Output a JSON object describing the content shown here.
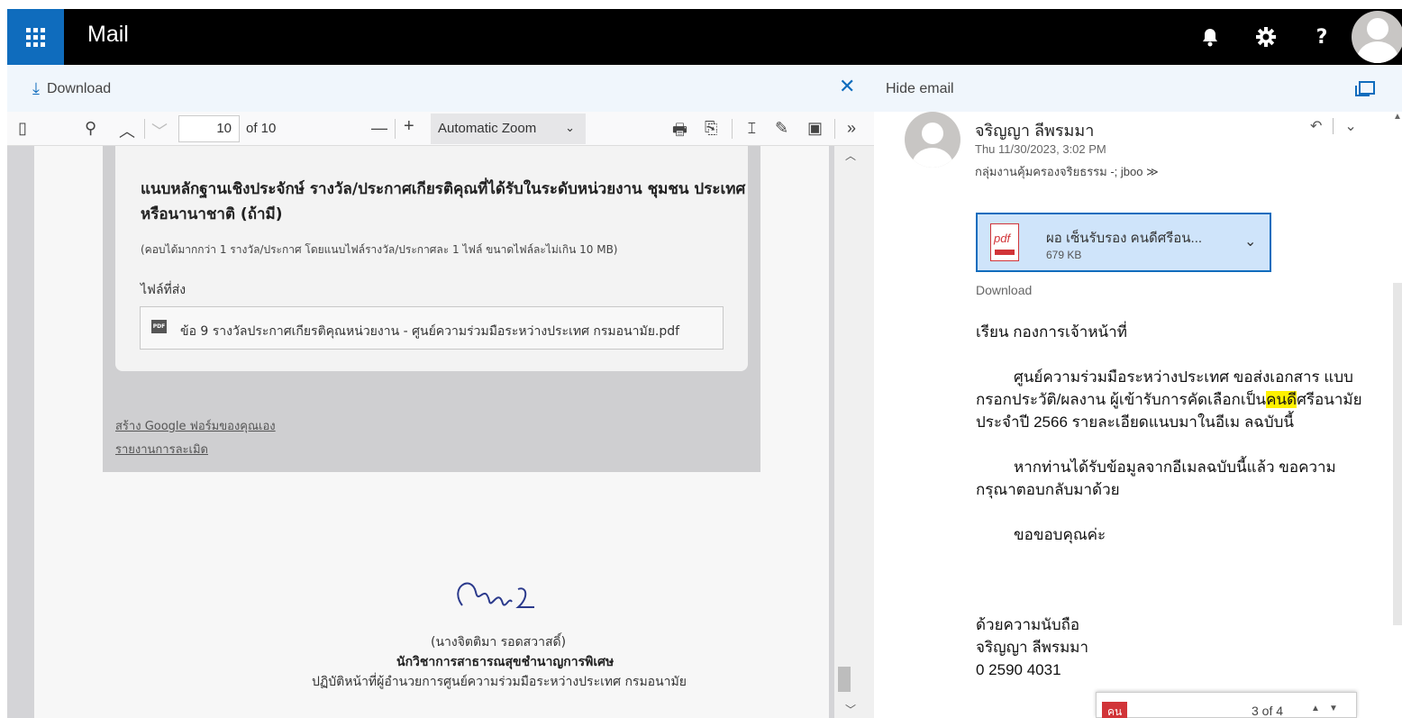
{
  "app": {
    "title": "Mail",
    "accent_color": "#0F6CBD",
    "icons": {
      "apps": "waffle-icon",
      "notifications": "bell-icon",
      "settings": "gear-icon",
      "help": "help-icon",
      "account": "avatar"
    }
  },
  "command_bar": {
    "download_label": "Download",
    "close_icon": "close-icon",
    "hide_email_label": "Hide email"
  },
  "pdf_toolbar": {
    "page_value": "10",
    "page_of": "of 10",
    "zoom_label": "Automatic Zoom"
  },
  "pdf_page": {
    "question_title": "แนบหลักฐานเชิงประจักษ์ รางวัล/ประกาศเกียรติคุณที่ได้รับในระดับหน่วยงาน ชุมชน ประเทศ หรือนานาชาติ (ถ้ามี)",
    "question_desc": "(คอบได้มากกว่า 1 รางวัล/ประกาศ โดยแนบไฟล์รางวัล/ประกาศละ 1 ไฟล์ ขนาดไฟล์ละไม่เกิน 10 MB)",
    "files_label": "ไฟล์ที่ส่ง",
    "file_name": "ข้อ 9 รางวัลประกาศเกียรติคุณหน่วยงาน - ศูนย์ความร่วมมือระหว่างประเทศ กรมอนามัย.pdf",
    "link_create_form": "สร้าง Google ฟอร์มของคุณเอง",
    "link_report": "รายงานการละเมิด",
    "signer_name": "(นางจิตติมา รอดสวาสดิ์)",
    "signer_position": "นักวิชาการสาธารณสุขชำนาญการพิเศษ",
    "signer_department": "ปฏิบัติหน้าที่ผู้อำนวยการศูนย์ความร่วมมือระหว่างประเทศ กรมอนามัย"
  },
  "email": {
    "sender": "จริญญา ลีพรมมา",
    "date": "Thu 11/30/2023, 3:02 PM",
    "to": "กลุ่มงานคุ้มครองจริยธรรม -; jboo ≫",
    "attachment": {
      "name": "ผอ เซ็นรับรอง คนดีศรีอน...",
      "size": "679 KB",
      "type_label": "pdf"
    },
    "download_label": "Download",
    "greeting": "เรียน กองการเจ้าหน้าที่",
    "para1_a": "ศูนย์ความร่วมมือระหว่างประเทศ ขอส่งเอกสาร แบบกรอกประวัติ/ผลงาน ผู้เข้ารับการคัดเลือกเป็น",
    "para1_hl": "คนดี",
    "para1_b": "ศรีอนามัย ประจำปี 2566 รายละเอียดแนบมาในอีเม ลฉบับนี้",
    "para2": "หากท่านได้รับข้อมูลจากอีเมลฉบับนี้แล้ว ขอความกรุณาตอบกลับมาด้วย",
    "thanks": "ขอขอบคุณค่ะ",
    "closing": "ด้วยความนับถือ",
    "sig_name": "จริญญา ลีพรมมา",
    "sig_phone": "0 2590 4031"
  },
  "find_bar": {
    "term": "คน",
    "count": "3 of 4"
  }
}
